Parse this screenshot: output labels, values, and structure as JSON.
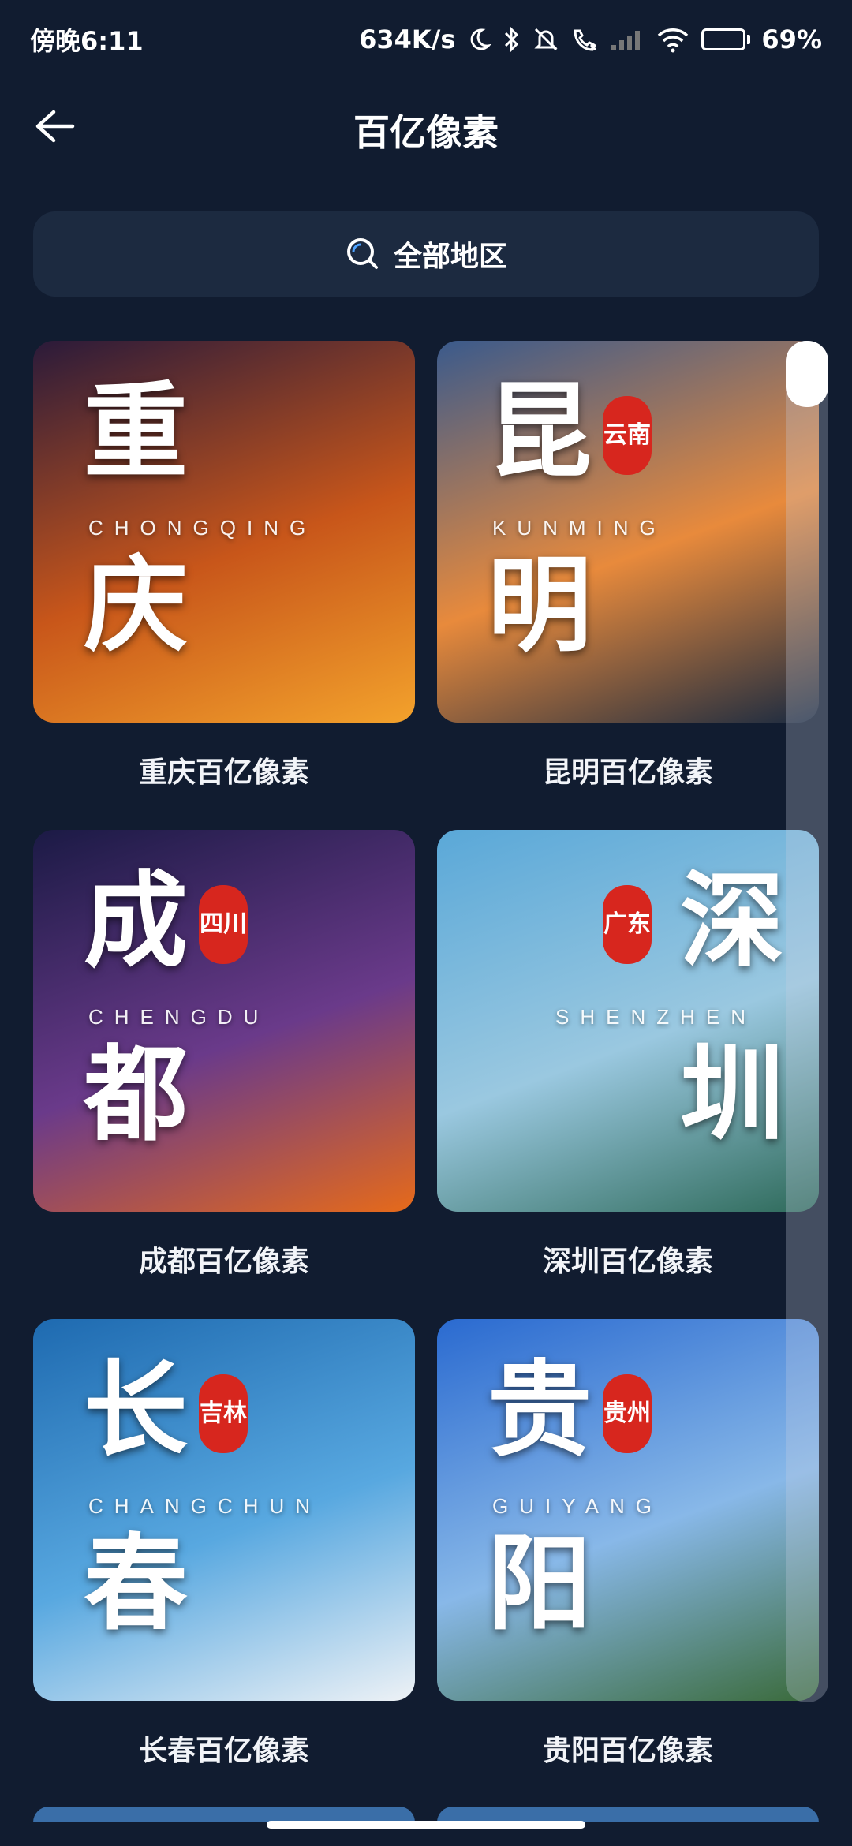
{
  "status_bar": {
    "time": "傍晚6:11",
    "net_speed": "634K/s",
    "battery_percent": "69%",
    "battery_level": 0.69,
    "icons": [
      "moon-icon",
      "bluetooth-icon",
      "mute-bell-icon",
      "call-icon",
      "signal-icon",
      "wifi-icon",
      "battery-icon"
    ]
  },
  "header": {
    "title": "百亿像素",
    "back_icon": "arrow-left-icon"
  },
  "search": {
    "label": "全部地区",
    "icon": "search-icon"
  },
  "cards": [
    {
      "caption": "重庆百亿像素",
      "char1": "重",
      "char2": "庆",
      "pinyin": "CHONGQING",
      "seal": "",
      "colors": [
        "#2a1a3a",
        "#c8561a",
        "#f3a22c"
      ]
    },
    {
      "caption": "昆明百亿像素",
      "char1": "昆",
      "char2": "明",
      "pinyin": "KUNMING",
      "seal": "云南",
      "colors": [
        "#3a5a8c",
        "#e88a3c",
        "#1a2a40"
      ]
    },
    {
      "caption": "成都百亿像素",
      "char1": "成",
      "char2": "都",
      "pinyin": "CHENGDU",
      "seal": "四川",
      "colors": [
        "#1b1a45",
        "#6a3a8a",
        "#e66a1a"
      ]
    },
    {
      "caption": "深圳百亿像素",
      "char1": "深",
      "char2": "圳",
      "pinyin": "SHENZHEN",
      "seal": "广东",
      "colors": [
        "#5aa8d8",
        "#9ac8e0",
        "#2e6a5a"
      ]
    },
    {
      "caption": "长春百亿像素",
      "char1": "长",
      "char2": "春",
      "pinyin": "CHANGCHUN",
      "seal": "吉林",
      "colors": [
        "#1e6ab0",
        "#58a8e0",
        "#eef2f6"
      ]
    },
    {
      "caption": "贵阳百亿像素",
      "char1": "贵",
      "char2": "阳",
      "pinyin": "GUIYANG",
      "seal": "贵州",
      "colors": [
        "#2a6ad0",
        "#88b8e8",
        "#3a6a3a"
      ]
    }
  ]
}
